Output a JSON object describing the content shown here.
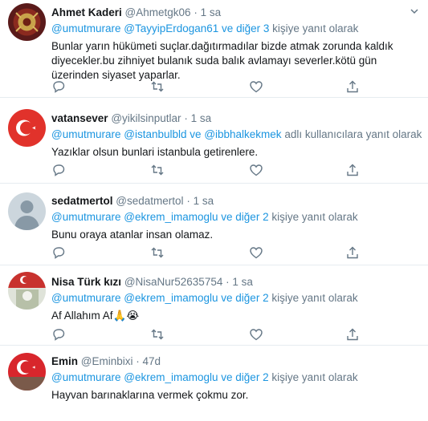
{
  "tweets": [
    {
      "name": "Ahmet Kaderi",
      "handle": "@Ahmetgk06",
      "dot": "·",
      "time": "1 sa",
      "reply_prefix": "",
      "mention1": "@umutmurare",
      "mention2": "@TayyipErdogan61",
      "connector": "ve",
      "mention3": "diğer 3",
      "reply_suffix": "kişiye yanıt olarak",
      "text": "Bunlar yarın hükümeti suçlar.dağıtırmadılar bizde atmak zorunda kaldık diyecekler.bu zihniyet bulanık suda balık avlamayı severler.kötü gün üzerinden siyaset yaparlar."
    },
    {
      "name": "vatansever",
      "handle": "@yikilsinputlar",
      "dot": "·",
      "time": "1 sa",
      "mention1": "@umutmurare",
      "mention2": "@istanbulbld",
      "connector": "ve",
      "mention3": "@ibbhalkekmek",
      "reply_suffix": "adlı kullanıcılara yanıt olarak",
      "text": "Yazıklar olsun bunlari istanbula getirenlere."
    },
    {
      "name": "sedatmertol",
      "handle": "@sedatmertol",
      "dot": "·",
      "time": "1 sa",
      "mention1": "@umutmurare",
      "mention2": "@ekrem_imamoglu",
      "connector": "ve",
      "mention3": "diğer 2",
      "reply_suffix": "kişiye yanıt olarak",
      "text": "Bunu oraya atanlar insan olamaz."
    },
    {
      "name": "Nisa Türk kızı",
      "handle": "@NisaNur52635754",
      "dot": "·",
      "time": "1 sa",
      "mention1": "@umutmurare",
      "mention2": "@ekrem_imamoglu",
      "connector": "ve",
      "mention3": "diğer 2",
      "reply_suffix": "kişiye yanıt olarak",
      "text": "Af Allahım Af🙏😭"
    },
    {
      "name": "Emin",
      "handle": "@Eminbixi",
      "dot": "·",
      "time": "47d",
      "mention1": "@umutmurare",
      "mention2": "@ekrem_imamoglu",
      "connector": "ve",
      "mention3": "diğer 2",
      "reply_suffix": "kişiye yanıt olarak",
      "text": "Hayvan barınaklarına vermek çokmu zor."
    }
  ],
  "colors": {
    "accent": "#1b95e0",
    "secondary": "#657786",
    "border": "#e6ecf0"
  },
  "icons": [
    "chevron-down-icon",
    "reply-icon",
    "retweet-icon",
    "like-icon",
    "share-icon"
  ]
}
